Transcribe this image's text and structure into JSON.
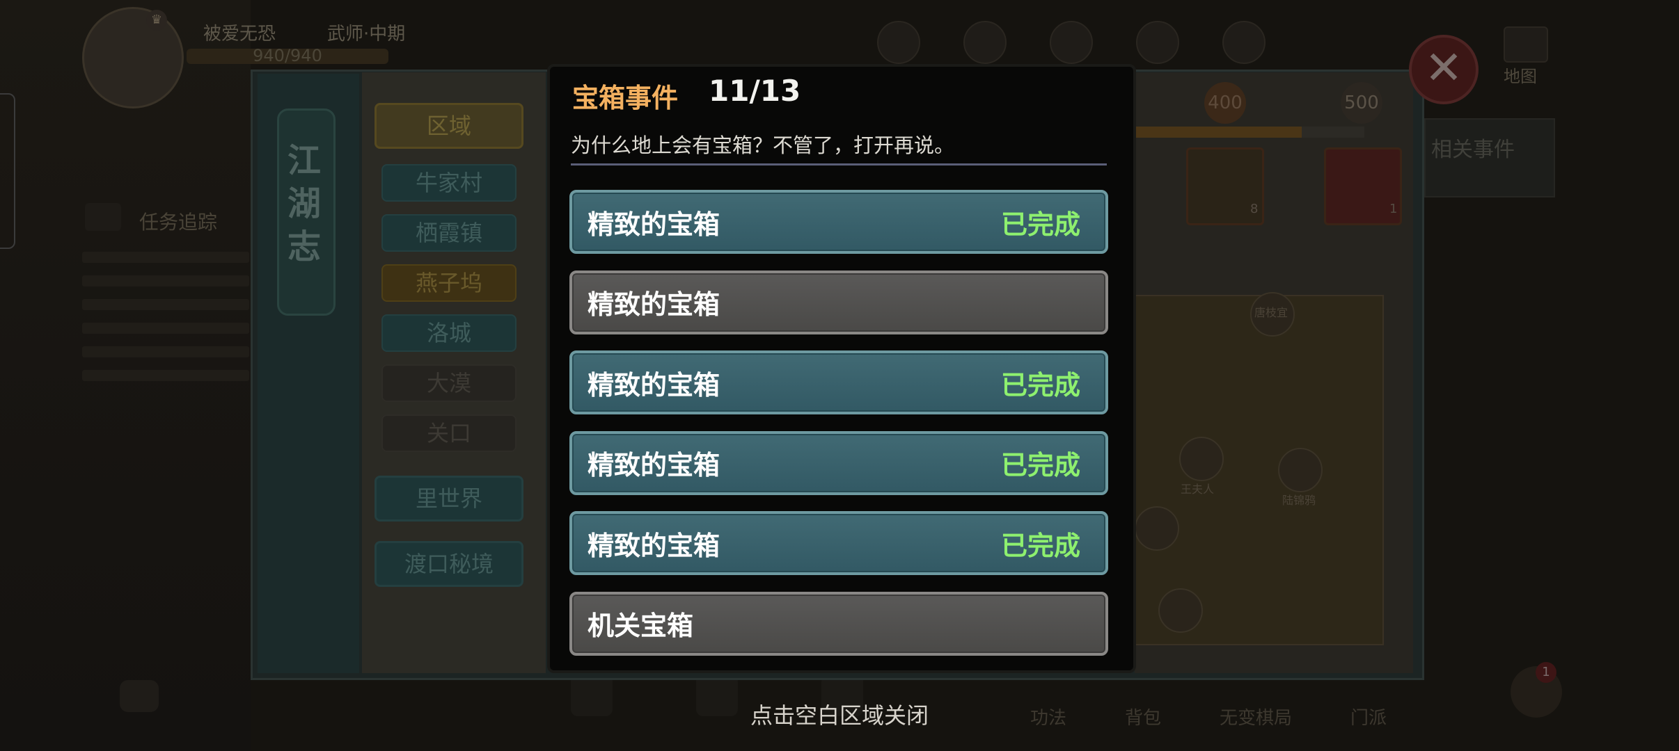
{
  "dialog": {
    "title": "宝箱事件",
    "count": "11/13",
    "description": "为什么地上会有宝箱？不管了，打开再说。",
    "events": [
      {
        "name": "精致的宝箱",
        "status": "已完成",
        "completed": true
      },
      {
        "name": "精致的宝箱",
        "status": "",
        "completed": false
      },
      {
        "name": "精致的宝箱",
        "status": "已完成",
        "completed": true
      },
      {
        "name": "精致的宝箱",
        "status": "已完成",
        "completed": true
      },
      {
        "name": "精致的宝箱",
        "status": "已完成",
        "completed": true
      },
      {
        "name": "机关宝箱",
        "status": "",
        "completed": false
      }
    ],
    "close_hint": "点击空白区域关闭"
  },
  "background": {
    "book_title": "江湖志",
    "area_header": "区域",
    "areas": [
      "牛家村",
      "栖霞镇",
      "燕子坞",
      "洛城",
      "大漠",
      "关口"
    ],
    "area_extra": [
      "里世界",
      "渡口秘境"
    ],
    "milestones": [
      "400",
      "500"
    ],
    "related_label": "相关事件",
    "player_name": "被爱无恐",
    "player_level": "武师·中期",
    "hp": "940/940",
    "quest_title": "任务追踪",
    "map_label": "地图",
    "reward_counts": [
      "8",
      "1"
    ],
    "npc_names": [
      "唐枝宜",
      "王夫人",
      "陆锦鸦"
    ],
    "bottom_labels": [
      "功法",
      "背包",
      "无变棋局",
      "门派"
    ]
  },
  "colors": {
    "title_orange": "#f4b160",
    "completed_green": "#8ef06f",
    "row_completed": "#3a6470",
    "row_pending": "#525150"
  }
}
